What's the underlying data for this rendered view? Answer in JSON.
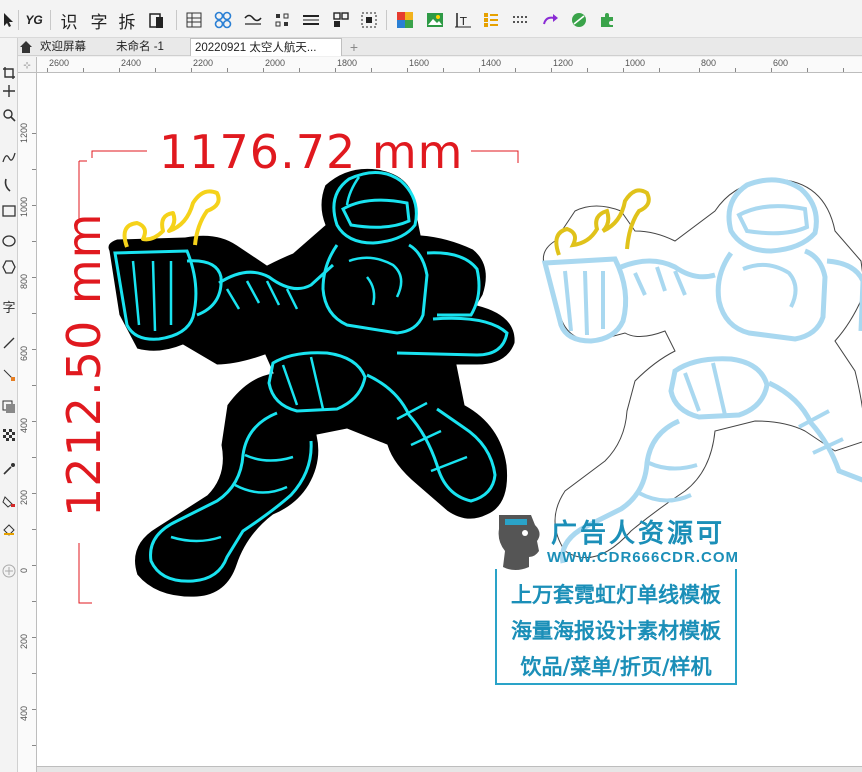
{
  "toolbar": {
    "yg_label": "YG",
    "recognize_label": "识",
    "char_label": "字",
    "split_label": "拆",
    "icons": [
      "pick-tool-icon",
      "yg-plugin-icon",
      "recognize-text-icon",
      "character-icon",
      "split-icon",
      "clipboard-icon",
      "table-icon",
      "node-icon",
      "wave-icon",
      "align-icon",
      "distribute-icon",
      "group-icon",
      "select-bounds-icon",
      "color-swatch-icon",
      "image-icon",
      "text-baseline-icon",
      "list-icon",
      "grid-dots-icon",
      "arrow-curve-icon",
      "leaf-icon",
      "puzzle-icon"
    ]
  },
  "tabs": [
    {
      "label": "欢迎屏幕",
      "active": false
    },
    {
      "label": "未命名 -1",
      "active": false
    },
    {
      "label": "20220921 太空人航天...",
      "active": true
    }
  ],
  "add_tab_label": "+",
  "ruler_top": {
    "labels": [
      "2600",
      "2400",
      "2200",
      "2000",
      "1800",
      "1600",
      "1400",
      "1200",
      "1000",
      "800",
      "600"
    ]
  },
  "ruler_left": {
    "labels": [
      "1200",
      "1000",
      "800",
      "600",
      "400",
      "200",
      "0",
      "200",
      "400"
    ]
  },
  "dimensions": {
    "width": "1176.72 mm",
    "height": "1212.50 mm"
  },
  "watermark": {
    "brand": "广告人资源可",
    "url": "WWW.CDR666CDR.COM",
    "line1": "上万套霓虹灯单线模板",
    "line2": "海量海报设计素材模板",
    "line3": "饮品/菜单/折页/样机"
  },
  "colors": {
    "dimension": "#e0191f",
    "neon_cyan": "#19e3f0",
    "neon_yellow": "#f5d21a",
    "outline_light_blue": "#a9d8f0",
    "watermark_blue": "#1b8fb8"
  }
}
